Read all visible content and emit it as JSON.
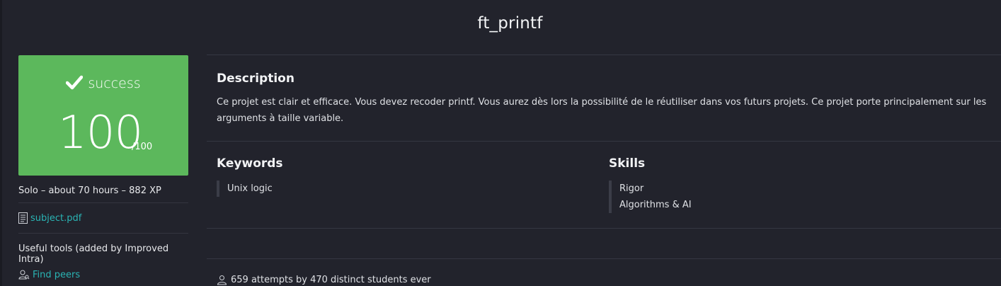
{
  "project": {
    "title": "ft_printf"
  },
  "grade": {
    "status": "success",
    "score": "100",
    "max": "/100",
    "color": "#5cb85c"
  },
  "sidebar": {
    "meta": "Solo – about 70 hours – 882 XP",
    "subject_link": "subject.pdf",
    "tools_title": "Useful tools (added by Improved Intra)",
    "find_peers": "Find peers"
  },
  "description": {
    "title": "Description",
    "text": "Ce projet est clair et efficace. Vous devez recoder printf. Vous aurez dès lors la possibilité de le réutiliser dans vos futurs projets. Ce projet porte principalement sur les arguments à taille variable."
  },
  "keywords": {
    "title": "Keywords",
    "items": [
      "Unix logic"
    ]
  },
  "skills": {
    "title": "Skills",
    "items": [
      "Rigor",
      "Algorithms & AI"
    ]
  },
  "stats": {
    "attempts": "659 attempts by 470 distinct students ever"
  },
  "theme": {
    "background": "#22232c",
    "accent_link": "#2ab4b4"
  }
}
